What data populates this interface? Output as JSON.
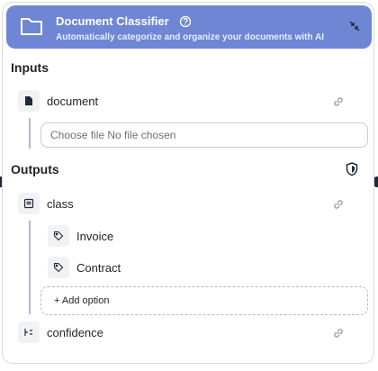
{
  "header": {
    "title": "Document Classifier",
    "subtitle": "Automatically categorize and organize your documents with AI",
    "icons": [
      "folder-icon",
      "help-icon",
      "collapse-icon"
    ],
    "color": "#6f86d4"
  },
  "inputs": {
    "section_title": "Inputs",
    "items": [
      {
        "label": "document",
        "icon": "file-icon",
        "file_input_text": "Choose file No file chosen"
      }
    ]
  },
  "outputs": {
    "section_title": "Outputs",
    "items": [
      {
        "label": "class",
        "icon": "list-icon",
        "options": [
          "Invoice",
          "Contract"
        ],
        "add_option_label": "+ Add option"
      },
      {
        "label": "confidence",
        "icon": "number-icon"
      }
    ]
  }
}
